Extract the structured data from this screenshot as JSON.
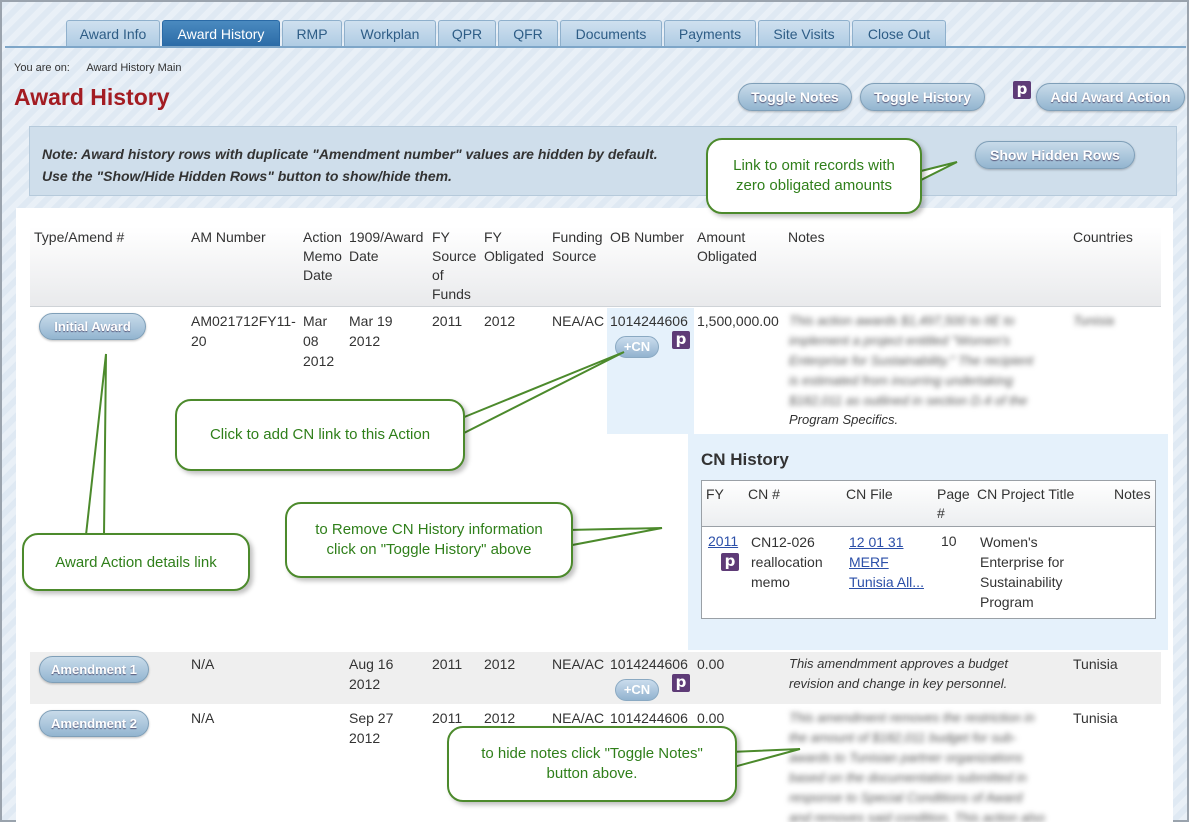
{
  "tabs": [
    "Award Info",
    "Award History",
    "RMP",
    "Workplan",
    "QPR",
    "QFR",
    "Documents",
    "Payments",
    "Site Visits",
    "Close Out"
  ],
  "breadcrumb": {
    "label": "You are on:",
    "page": "Award History Main"
  },
  "page_title": "Award History",
  "buttons": {
    "toggle_notes": "Toggle Notes",
    "toggle_history": "Toggle History",
    "add_action": "Add Award Action",
    "show_hidden": "Show Hidden Rows",
    "cn": "+CN",
    "p": "p"
  },
  "note": {
    "line1": "Note: Award history rows with duplicate \"Amendment number\" values are hidden by default.",
    "line2": "Use the \"Show/Hide Hidden Rows\" button to show/hide them."
  },
  "columns": {
    "type": "Type/Amend #",
    "am": "AM Number",
    "memo": [
      "Action",
      "Memo",
      "Date"
    ],
    "award": [
      "1909/Award",
      "Date"
    ],
    "fysrc": [
      "FY",
      "Source",
      "of",
      "Funds"
    ],
    "fyobl": [
      "FY",
      "Obligated"
    ],
    "fund": [
      "Funding",
      "Source"
    ],
    "ob": "OB Number",
    "amt": [
      "Amount",
      "Obligated"
    ],
    "notes": "Notes",
    "countries": "Countries"
  },
  "rows": [
    {
      "type": "Initial Award",
      "am": [
        "AM021712FY11-",
        "20"
      ],
      "memo": [
        "Mar",
        "08",
        "2012"
      ],
      "award": [
        "Mar 19",
        "2012"
      ],
      "fysrc": "2011",
      "fyobl": "2012",
      "fund": "NEA/AC",
      "ob": "1014244606",
      "amt": "1,500,000.00",
      "notes": [
        "This action awards $1,497,500 to IIE to",
        "implement a project entitled \"Women's",
        "Enterprise for Sustainability.\" The recipient",
        "is estimated from incurring undertaking",
        "$182,011 as outlined in section D.4 of the",
        "Program Specifics."
      ],
      "countries": "Tunisia"
    },
    {
      "type": "Amendment 1",
      "am": "N/A",
      "award": [
        "Aug 16",
        "2012"
      ],
      "fysrc": "2011",
      "fyobl": "2012",
      "fund": "NEA/AC",
      "ob": "1014244606",
      "amt": "0.00",
      "notes": [
        "This amendmment approves a budget",
        "revision and change in key personnel."
      ],
      "countries": "Tunisia"
    },
    {
      "type": "Amendment 2",
      "am": "N/A",
      "award": [
        "Sep 27",
        "2012"
      ],
      "fysrc": "2011",
      "fyobl": "2012",
      "fund": "NEA/AC",
      "ob": "1014244606",
      "amt": "0.00",
      "notes": [
        "This amendment removes the restriction in",
        "the amount of $182,011 budget for sub-",
        "awards to Tunisian partner organizations",
        "based on the documentation submitted in",
        "response to Special Conditions of Award",
        "and removes said condition. This action also"
      ],
      "countries": "Tunisia"
    }
  ],
  "cn_history": {
    "title": "CN History",
    "headers": {
      "fy": "FY",
      "cn": "CN #",
      "file": "CN File",
      "page": [
        "Page",
        "#"
      ],
      "title": "CN Project Title",
      "notes": "Notes"
    },
    "row": {
      "fy": "2011",
      "cn": [
        "CN12-026",
        "reallocation",
        "memo"
      ],
      "file": [
        "12 01 31",
        "MERF",
        "Tunisia All..."
      ],
      "page": "10",
      "title": [
        "Women's",
        "Enterprise for",
        "Sustainability",
        "Program"
      ]
    }
  },
  "callouts": {
    "omit": [
      "Link to omit records with",
      "zero obligated amounts"
    ],
    "add_cn": "Click to add CN link to this Action",
    "remove_cn": [
      "to Remove CN History information",
      "click on \"Toggle History\" above"
    ],
    "details": "Award Action details link",
    "hide_notes": [
      "to hide notes click \"Toggle Notes\"",
      "button above."
    ]
  }
}
